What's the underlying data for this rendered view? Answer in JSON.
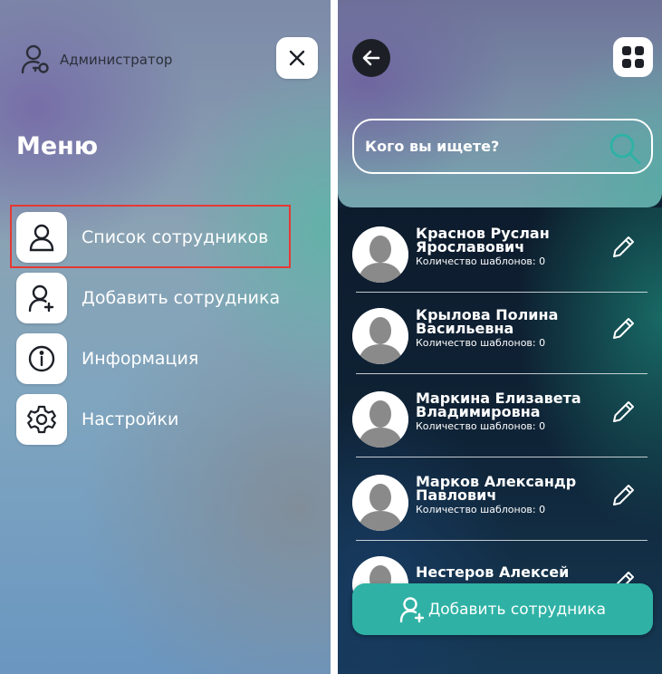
{
  "menu_screen": {
    "admin_label": "Администратор",
    "title": "Меню",
    "items": [
      {
        "label": "Список сотрудников",
        "icon": "user-icon"
      },
      {
        "label": "Добавить сотрудника",
        "icon": "user-plus-icon"
      },
      {
        "label": "Информация",
        "icon": "info-icon"
      },
      {
        "label": "Настройки",
        "icon": "gear-icon"
      }
    ],
    "highlighted_item": "Список сотрудников"
  },
  "list_screen": {
    "search": {
      "placeholder": "Кого вы ищете?"
    },
    "employees": [
      {
        "name": "Краснов Руслан Ярославович",
        "templates": "Количество шаблонов: 0"
      },
      {
        "name": "Крылова Полина Васильевна",
        "templates": "Количество шаблонов: 0"
      },
      {
        "name": "Маркина Елизавета Владимировна",
        "templates": "Количество шаблонов: 0"
      },
      {
        "name": "Марков Александр Павлович",
        "templates": "Количество шаблонов: 0"
      },
      {
        "name": "Нестеров Алексей",
        "templates": ""
      }
    ],
    "add_button_label": "Добавить сотрудника"
  },
  "colors": {
    "accent": "#2fb2a5",
    "highlight_border": "#e53935",
    "list_background": "#0e2033"
  }
}
